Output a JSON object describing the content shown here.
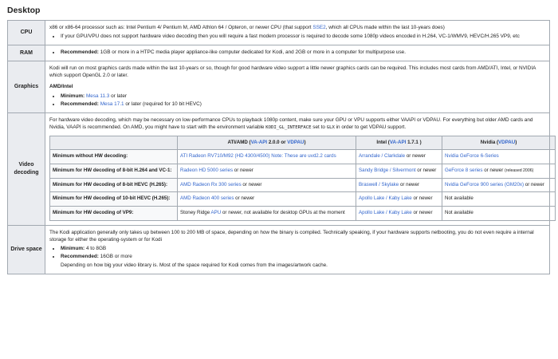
{
  "heading": "Desktop",
  "cpu": {
    "label": "CPU",
    "line1_pre": "x86 or x86-64 processor such as: Intel Pentium 4/ Pentium M, AMD Athlon 64 / Opteron, or newer CPU (that support ",
    "line1_link": "SSE2",
    "line1_post": ", which all CPUs made within the last 10-years does)",
    "bullet": "If your GPU/VPU does not support hardware video decoding then you will require a fast modern processor is required to decode some 1080p videos encoded in H.264, VC-1/WMV9, HEVC/H.265 VP9, etc"
  },
  "ram": {
    "label": "RAM",
    "bold": "Recommended:",
    "text": " 1GB or more in a HTPC media player appliance-like computer dedicated for Kodi, and 2GB or more in a computer for multipurpose use."
  },
  "graphics": {
    "label": "Graphics",
    "intro": "Kodi will run on most graphics cards made within the last 10-years or so, though for good hardware video support a little newer graphics cards can be required. This includes most cards from AMD/ATI, Intel, or NVIDIA which support OpenGL 2.0 or later.",
    "sub": "AMD/Intel",
    "min_bold": "Minimum:",
    "min_link": "Mesa 11.3",
    "min_post": " or later",
    "rec_bold": "Recommended:",
    "rec_link": "Mesa 17.1",
    "rec_post": " or later (required for 10 bit HEVC)"
  },
  "video": {
    "label": "Video decoding",
    "intro_pre": "For hardware video decoding, which may be necessary on low-performance CPUs to playback 1080p content, make sure your GPU or VPU supports either VAAPI or VDPAU. For everything but older AMD cards and Nvidia, VAAPI is recommended. On AMD, you might have to start with the environment variable ",
    "code1": "KODI_GL_INTERFACE",
    "intro_mid1": " set to ",
    "code2": "GLX",
    "intro_mid2": " in order to get VDPAU support.",
    "col_ati_pre": "ATI/AMD (",
    "col_ati_link1": "VA-API",
    "col_ati_mid": " 2.0.0 or ",
    "col_ati_link2": "VDPAU",
    "col_ati_post": ")",
    "col_intel_pre": "Intel (",
    "col_intel_link": "VA-API",
    "col_intel_post": " 1.7.1 )",
    "col_nv_pre": "Nvidia (",
    "col_nv_link": "VDPAU",
    "col_nv_post": ")",
    "rows": [
      {
        "label": "Minimum without HW decoding:",
        "ati_link": "ATI Radeon RV710/M92 (HD 4300/4500) Note: These are uvd2.2 cards",
        "ati_post": "",
        "intel_link": "Arrandale / Clarkdale",
        "intel_post": " or newer",
        "nv_link": "Nvidia GeForce 6-Series",
        "nv_post": "",
        "nv_small": ""
      },
      {
        "label": "Minimum for HW decoding of 8-bit H.264 and VC-1:",
        "ati_link": "Radeon HD 5000 series",
        "ati_post": " or newer",
        "intel_link": "Sandy Bridge / Silvermont",
        "intel_post": " or newer",
        "nv_link": "GeForce 8 series",
        "nv_post": " or newer ",
        "nv_small": "(released 2006)"
      },
      {
        "label": "Minimum for HW decoding of 8-bit HEVC (H.265):",
        "ati_link": "AMD Radeon Rx 300 series",
        "ati_post": " or newer",
        "intel_link": "Braswell / Skylake",
        "intel_post": " or newer",
        "nv_link": "Nvidia GeForce 900 series (GM20x)",
        "nv_post": " or newer",
        "nv_small": ""
      },
      {
        "label": "Minimum for HW decoding of 10-bit HEVC (H.265):",
        "ati_link": "AMD Radeon 400 series",
        "ati_post": " or newer",
        "intel_link": "Apollo Lake / Kaby Lake",
        "intel_post": " or newer",
        "nv_link": "",
        "nv_post": "Not available",
        "nv_small": ""
      },
      {
        "label": "Minimum for HW decoding of VP9:",
        "ati_pre": "Stoney Ridge ",
        "ati_link": "APU",
        "ati_post": " or newer, not available for desktop GPUs at the moment",
        "intel_link": "Apollo Lake / Kaby Lake",
        "intel_post": " or newer",
        "nv_link": "",
        "nv_post": "Not available",
        "nv_small": ""
      }
    ]
  },
  "drive": {
    "label": "Drive space",
    "intro": "The Kodi application generally only takes up between 100 to 200 MB of space, depending on how the binary is compiled. Technically speaking, if your hardware supports netbooting, you do not even require a internal storage for either the operating-system or for Kodi",
    "min_bold": "Minimum:",
    "min_text": " 4 to 8GB",
    "rec_bold": "Recommended:",
    "rec_text": " 16GB or more",
    "note": "Depending on how big your video library is. Most of the space required for Kodi comes from the images/artwork cache."
  },
  "colors": {
    "link": "#3366cc",
    "header_bg": "#eaecf0",
    "border": "#a2a9b1"
  }
}
